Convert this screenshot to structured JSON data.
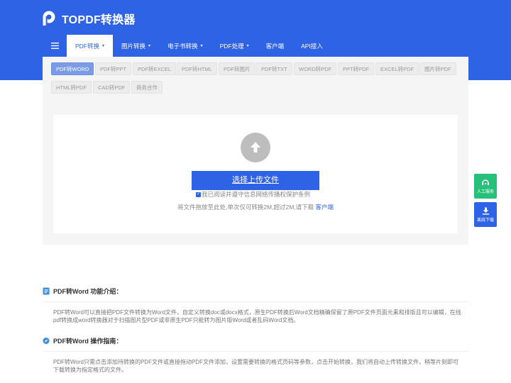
{
  "brand": {
    "name": "TOPDF转换器",
    "color": "#2f63e6"
  },
  "nav": {
    "menu_icon": "hamburger-icon",
    "items": [
      {
        "label": "PDF转换",
        "caret": "▾"
      },
      {
        "label": "图片转换",
        "caret": "▾"
      },
      {
        "label": "电子书转换",
        "caret": "▾"
      },
      {
        "label": "PDF处理",
        "caret": "▾"
      },
      {
        "label": "客户端"
      },
      {
        "label": "API接入"
      }
    ]
  },
  "formats": [
    "PDF转WORD",
    "PDF转PPT",
    "PDF转EXCEL",
    "PDF转HTML",
    "PDF转图片",
    "PDF转TXT",
    "WORD转PDF",
    "PPT转PDF",
    "EXCEL转PDF",
    "图片转PDF",
    "HTML转PDF",
    "CAD转PDF",
    "商务合作"
  ],
  "upload": {
    "button_label": "选择上传文件",
    "agree_text": "我已阅读并遵守信息网络传播权保护条例",
    "hint_text": "将文件拖放至此处,单次仅可转换2M,超过2M,请下载",
    "hint_link": "客户端"
  },
  "side": {
    "service_label": "人工服务",
    "download_label": "离线下载"
  },
  "sections": [
    {
      "title": "PDF转Word 功能介绍：",
      "icon": "document-icon",
      "text": "PDF转Word可以直接把PDF文件转换为Word文件，自定义转换doc或docx格式，原生PDF转换后Word文档精确保留了原PDF文件页面元素和排版且可以编辑，在线pdf转换成word转换器对于扫描图片型PDF或非原生PDF只能转为图片版Word或者乱码Word文档。"
    },
    {
      "title": "PDF转Word 操作指南：",
      "icon": "compass-icon",
      "text": "PDF转Word只需点击添加待转换的PDF文件或直接拖动PDF文件添加，设置需要转换的格式页码等参数，点击开始转换，我们将自动上传转换文件，稍等片刻即可下载转换为指定格式的文件。"
    }
  ]
}
